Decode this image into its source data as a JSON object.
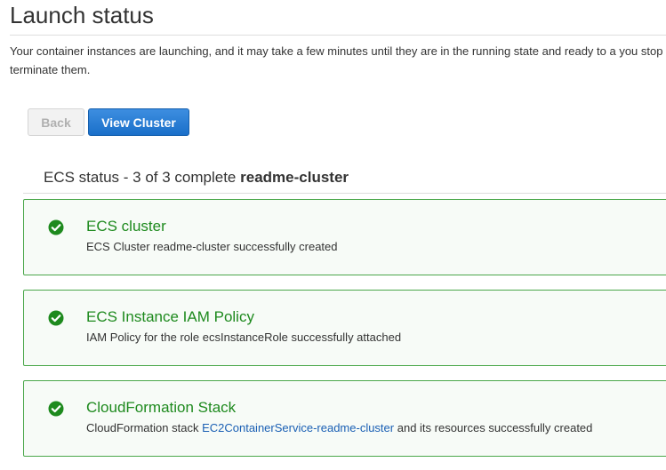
{
  "page": {
    "title": "Launch status",
    "intro": "Your container instances are launching, and it may take a few minutes until they are in the running state and ready to a you stop or terminate them."
  },
  "buttons": {
    "back_label": "Back",
    "view_cluster_label": "View Cluster"
  },
  "ecs_status": {
    "prefix": "ECS status - 3 of 3 complete",
    "cluster_name": "readme-cluster"
  },
  "steps": [
    {
      "icon": "check-circle-icon",
      "title": "ECS cluster",
      "description": "ECS Cluster readme-cluster successfully created"
    },
    {
      "icon": "check-circle-icon",
      "title": "ECS Instance IAM Policy",
      "description": "IAM Policy for the role ecsInstanceRole successfully attached"
    },
    {
      "icon": "check-circle-icon",
      "title": "CloudFormation Stack",
      "description_prefix": "CloudFormation stack",
      "link_text": "EC2ContainerService-readme-cluster",
      "description_suffix": "and its resources successfully created"
    }
  ],
  "colors": {
    "success_green": "#1e8a1e",
    "card_border": "#4aa74a",
    "primary_button": "#1a6fc9",
    "link_blue": "#1a5fb4"
  }
}
